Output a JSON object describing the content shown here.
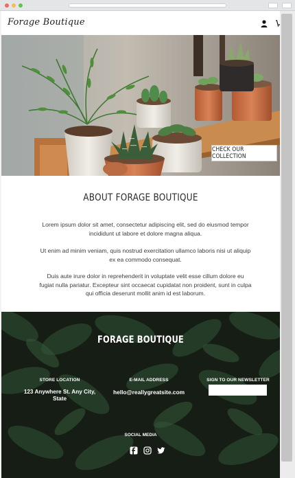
{
  "header": {
    "logo": "Forage Boutique",
    "icons": [
      "user-icon",
      "cart-icon"
    ]
  },
  "hero": {
    "cta_label": "CHECK OUR COLLECTION"
  },
  "about": {
    "title": "ABOUT FORAGE BOUTIQUE",
    "paragraphs": [
      "Lorem ipsum dolor sit amet, consectetur adipiscing elit, sed do eiusmod tempor incididunt ut labore et dolore magna aliqua.",
      "Ut enim ad minim veniam, quis nostrud exercitation ullamco laboris nisi ut aliquip ex ea commodo consequat.",
      "Duis aute irure dolor in reprehenderit in voluptate velit esse cillum dolore eu fugiat nulla pariatur. Excepteur sint occaecat cupidatat non proident, sunt in culpa qui officia deserunt mollit anim id est laborum."
    ]
  },
  "footer": {
    "title": "FORAGE BOUTIQUE",
    "store_label": "STORE LOCATION",
    "store_address": "123 Anywhere St. Any City, State",
    "email_label": "E-MAIL ADDRESS",
    "email_value": "hello@reallygreatsite.com",
    "newsletter_label": "SIGN TO OUR NEWSLETTER",
    "newsletter_placeholder": "",
    "social_label": "SOCIAL MEDIA",
    "social_icons": [
      "facebook-icon",
      "instagram-icon",
      "twitter-icon"
    ]
  },
  "colors": {
    "footer_bg": "#1f2a1e",
    "leaf": "#3e6b3a",
    "terracotta": "#c86d44"
  }
}
